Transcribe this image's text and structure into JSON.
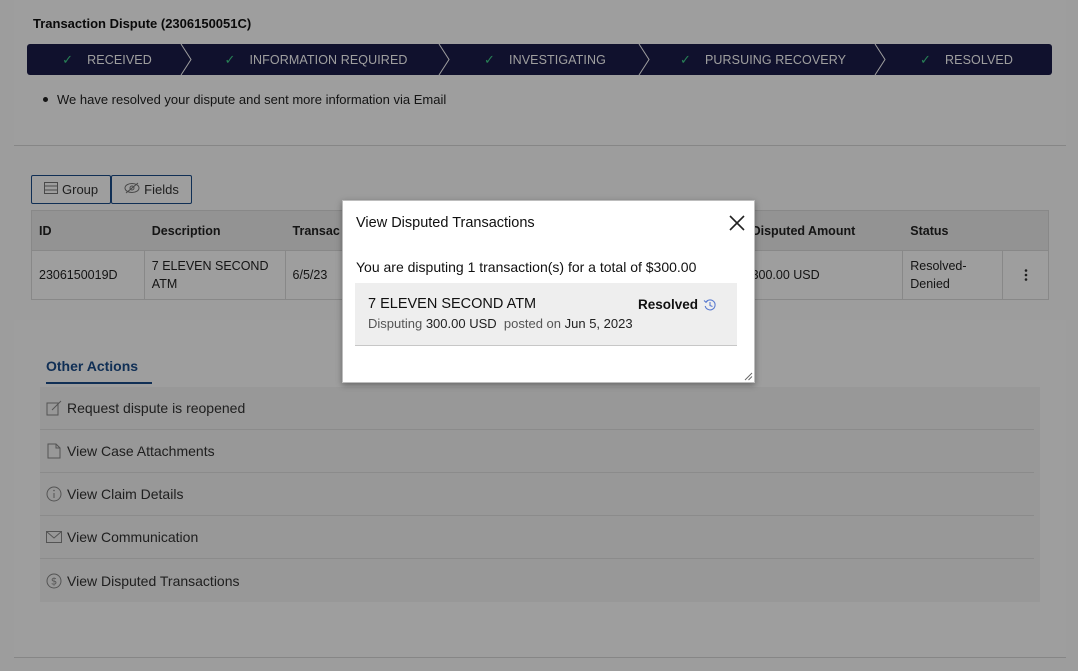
{
  "case": {
    "title": "Transaction Dispute (2306150051C)",
    "steps": [
      {
        "label": "RECEIVED",
        "state": "complete"
      },
      {
        "label": "INFORMATION REQUIRED",
        "state": "complete"
      },
      {
        "label": "INVESTIGATING",
        "state": "complete"
      },
      {
        "label": "PURSUING RECOVERY",
        "state": "complete"
      },
      {
        "label": "RESOLVED",
        "state": "complete"
      }
    ],
    "note": "We have resolved your dispute and sent more information via Email"
  },
  "toolbar": {
    "group_label": "Group",
    "fields_label": "Fields"
  },
  "table": {
    "headers": [
      "ID",
      "Description",
      "Transac",
      "Disputed Amount",
      "Status"
    ],
    "rows": [
      {
        "id": "2306150019D",
        "description": "7 ELEVEN SECOND ATM",
        "transaction_date": "6/5/23",
        "disputed_amount": "300.00 USD",
        "status": "Resolved-Denied"
      }
    ]
  },
  "other_actions": {
    "tab_label": "Other Actions",
    "items": [
      {
        "label": "Request dispute is reopened",
        "icon": "edit-icon"
      },
      {
        "label": "View Case Attachments",
        "icon": "document-icon"
      },
      {
        "label": "View Claim Details",
        "icon": "info-icon"
      },
      {
        "label": "View Communication",
        "icon": "envelope-icon"
      },
      {
        "label": "View Disputed Transactions",
        "icon": "dollar-circle-icon"
      }
    ]
  },
  "modal": {
    "title": "View Disputed Transactions",
    "summary": "You are disputing 1 transaction(s) for a total of $300.00",
    "transaction": {
      "name": "7 ELEVEN SECOND ATM",
      "status": "Resolved",
      "disputing_label": "Disputing",
      "amount": "300.00 USD",
      "posted_label": "posted on",
      "posted_date": "Jun 5, 2023"
    }
  },
  "colors": {
    "stepper_bg": "#1b1c4a",
    "check": "#3fd08a",
    "link_blue": "#1b4c8a"
  }
}
